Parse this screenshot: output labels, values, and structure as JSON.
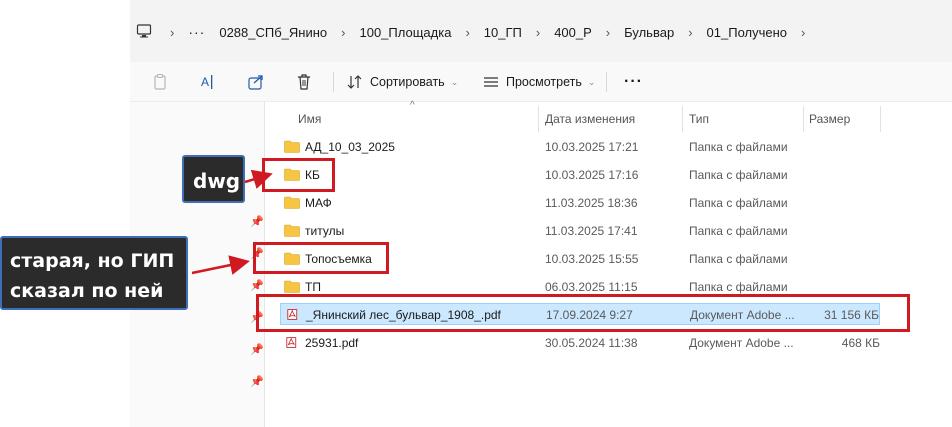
{
  "address_bar": {
    "overflow_label": "···",
    "crumbs": [
      "0288_СПб_Янино",
      "100_Площадка",
      "10_ГП",
      "400_Р",
      "Бульвар",
      "01_Получено"
    ]
  },
  "command_bar": {
    "sort_label": "Сортировать",
    "view_label": "Просмотреть",
    "more_label": "···"
  },
  "columns": {
    "name": "Имя",
    "date": "Дата изменения",
    "type": "Тип",
    "size": "Размер"
  },
  "files": [
    {
      "name": "АД_10_03_2025",
      "date": "10.03.2025 17:21",
      "type": "Папка с файлами",
      "size": "",
      "kind": "folder"
    },
    {
      "name": "КБ",
      "date": "10.03.2025 17:16",
      "type": "Папка с файлами",
      "size": "",
      "kind": "folder"
    },
    {
      "name": "МАФ",
      "date": "11.03.2025 18:36",
      "type": "Папка с файлами",
      "size": "",
      "kind": "folder"
    },
    {
      "name": "титулы",
      "date": "11.03.2025 17:41",
      "type": "Папка с файлами",
      "size": "",
      "kind": "folder"
    },
    {
      "name": "Топосъемка",
      "date": "10.03.2025 15:55",
      "type": "Папка с файлами",
      "size": "",
      "kind": "folder"
    },
    {
      "name": "ТП",
      "date": "06.03.2025 11:15",
      "type": "Папка с файлами",
      "size": "",
      "kind": "folder"
    },
    {
      "name": "_Янинский лес_бульвар_1908_.pdf",
      "date": "17.09.2024 9:27",
      "type": "Документ Adobe ...",
      "size": "31 156 КБ",
      "kind": "pdf",
      "selected": true
    },
    {
      "name": "25931.pdf",
      "date": "30.05.2024 11:38",
      "type": "Документ Adobe ...",
      "size": "468 КБ",
      "kind": "pdf"
    }
  ],
  "annotations": {
    "dwg_label": "dwg",
    "old_note_line1": "старая, но ГИП",
    "old_note_line2": "сказал по ней"
  },
  "colors": {
    "annotation_red": "#d01a22",
    "callout_bg": "#2b2b2b",
    "callout_border": "#3c6fb5",
    "folder": "#f6c543",
    "selection": "#cce8ff",
    "pdf_red": "#c4161c"
  },
  "icons": {
    "computer": "computer-icon",
    "copy": "copy-icon",
    "rename": "rename-icon",
    "share": "share-icon",
    "delete": "delete-icon",
    "sort": "sort-icon",
    "view": "view-icon",
    "pin": "pin-icon",
    "folder": "folder-icon",
    "pdf": "pdf-icon"
  }
}
